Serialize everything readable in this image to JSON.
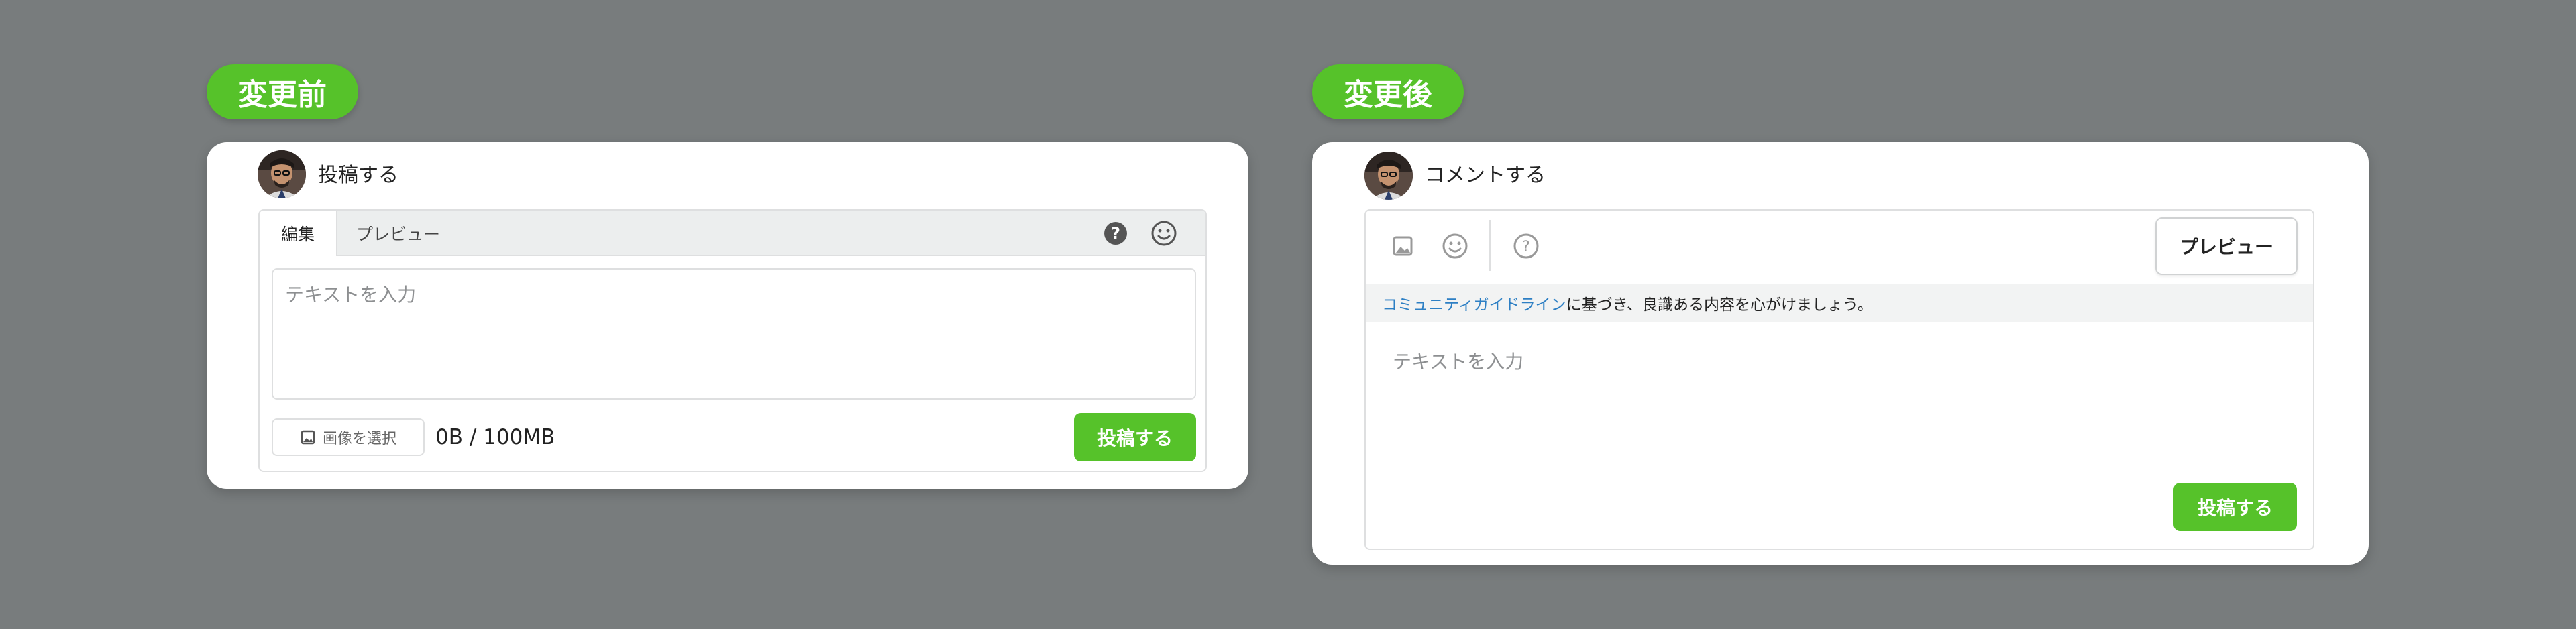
{
  "before": {
    "label": "変更前",
    "title": "投稿する",
    "tabs": {
      "edit": "編集",
      "preview": "プレビュー"
    },
    "placeholder": "テキストを入力",
    "image_button": "画像を選択",
    "size_text": "0B / 100MB",
    "submit": "投稿する",
    "icons": [
      "help-icon",
      "emoji-icon",
      "image-icon"
    ]
  },
  "after": {
    "label": "変更後",
    "title": "コメントする",
    "preview": "プレビュー",
    "notice_link": "コミュニティガイドライン",
    "notice_text": "に基づき、良識ある内容を心がけましょう。",
    "placeholder": "テキストを入力",
    "submit": "投稿する",
    "icons": [
      "image-icon",
      "emoji-icon",
      "help-icon"
    ]
  },
  "colors": {
    "background": "#787c7d",
    "accent": "#56c22a",
    "link": "#2d7fc4"
  }
}
